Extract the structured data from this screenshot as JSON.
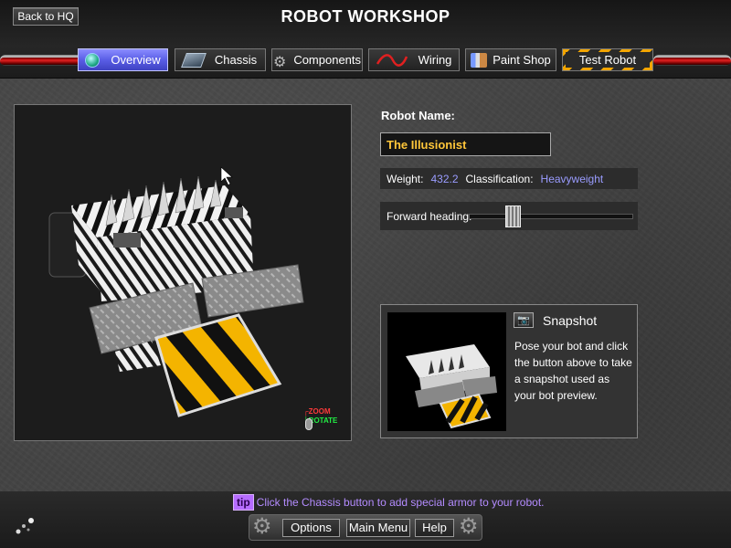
{
  "header": {
    "back_button": "Back to HQ",
    "title": "ROBOT WORKSHOP"
  },
  "tabs": [
    {
      "label": "Overview",
      "icon": "globe-icon",
      "active": true
    },
    {
      "label": "Chassis",
      "icon": "chassis-icon",
      "active": false
    },
    {
      "label": "Components",
      "icon": "gear-icon",
      "active": false
    },
    {
      "label": "Wiring",
      "icon": "wire-icon",
      "active": false
    },
    {
      "label": "Paint Shop",
      "icon": "paint-icon",
      "active": false
    },
    {
      "label": "Test Robot",
      "icon": "",
      "active": false
    }
  ],
  "viewport": {
    "legend_zoom": "ZOOM",
    "legend_rotate": "ROTATE",
    "colors": {
      "zoom": "#ff3a3a",
      "rotate": "#22ee44"
    }
  },
  "robot": {
    "name_label": "Robot Name:",
    "name_value": "The Illusionist",
    "weight_label": "Weight:",
    "weight_value": "432.2",
    "class_label": "Classification:",
    "class_value": "Heavyweight",
    "heading_label": "Forward heading:",
    "heading_level": 0.27
  },
  "snapshot": {
    "title": "Snapshot",
    "description": "Pose your bot and click the button above to take a snapshot used as your bot preview."
  },
  "tip": {
    "badge": "tip",
    "text": "Click the Chassis button to add special armor to your robot."
  },
  "menu": {
    "options": "Options",
    "main_menu": "Main Menu",
    "help": "Help"
  },
  "colors": {
    "accent": "#5a5ee6",
    "name_text": "#ffc63a",
    "value_text": "#9a9cff",
    "tip": "#b48cff",
    "caution_yellow": "#f2a500"
  }
}
